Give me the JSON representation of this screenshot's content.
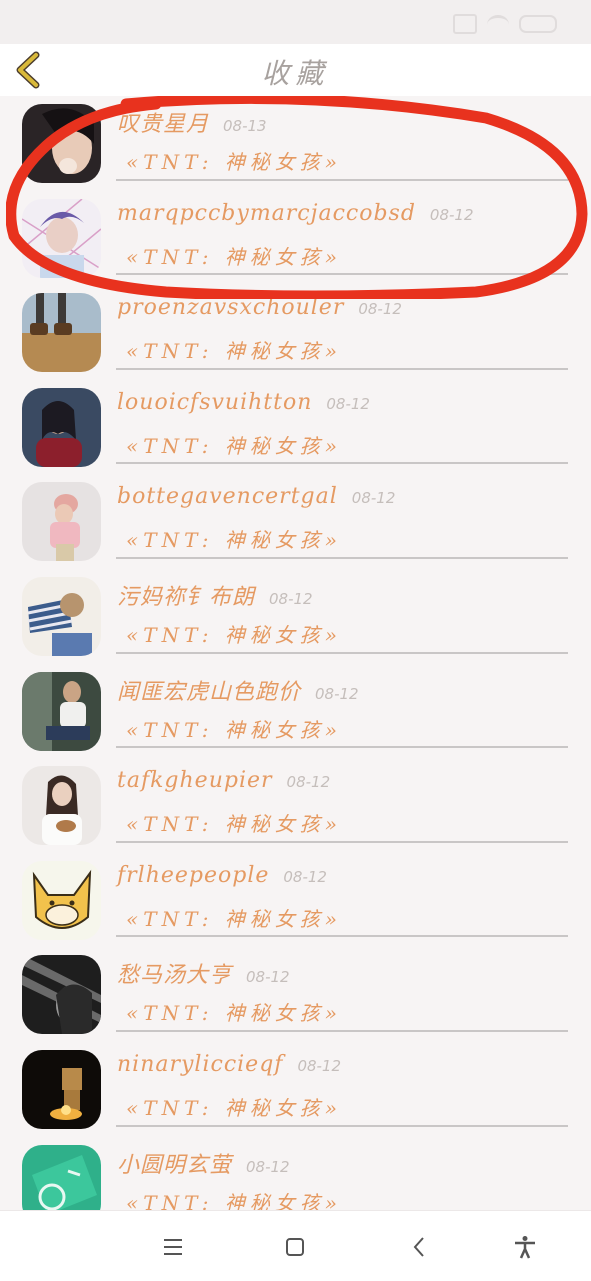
{
  "header": {
    "title": "收藏"
  },
  "favorites": [
    {
      "name": "叹贵星月",
      "date": "08-13",
      "work": "«TNT: 神秘女孩»"
    },
    {
      "name": "marqpccbymarcjaccobsd",
      "date": "08-12",
      "work": "«TNT: 神秘女孩»"
    },
    {
      "name": "proenzavsxchouler",
      "date": "08-12",
      "work": "«TNT: 神秘女孩»"
    },
    {
      "name": "louoicfsvuihtton",
      "date": "08-12",
      "work": "«TNT: 神秘女孩»"
    },
    {
      "name": "bottegavencertgal",
      "date": "08-12",
      "work": "«TNT: 神秘女孩»"
    },
    {
      "name": "污妈祢钅布朗",
      "date": "08-12",
      "work": "«TNT: 神秘女孩»"
    },
    {
      "name": "闻匪宏虎山色跑价",
      "date": "08-12",
      "work": "«TNT: 神秘女孩»"
    },
    {
      "name": "tafkgheupier",
      "date": "08-12",
      "work": "«TNT: 神秘女孩»"
    },
    {
      "name": "frlheepeople",
      "date": "08-12",
      "work": "«TNT: 神秘女孩»"
    },
    {
      "name": "愁马汤大亨",
      "date": "08-12",
      "work": "«TNT: 神秘女孩»"
    },
    {
      "name": "ninaryliccieqf",
      "date": "08-12",
      "work": "«TNT: 神秘女孩»"
    },
    {
      "name": "小圆明玄萤",
      "date": "08-12",
      "work": "«TNT: 神秘女孩»"
    }
  ],
  "colors": {
    "accent": "#e59a62",
    "annotation": "#e8321e",
    "back_arrow": "#d9b93a"
  },
  "icons": {
    "back": "chevron-left-icon",
    "nav_menu": "menu-icon",
    "nav_home": "square-icon",
    "nav_back": "back-icon",
    "nav_accessibility": "accessibility-icon"
  }
}
